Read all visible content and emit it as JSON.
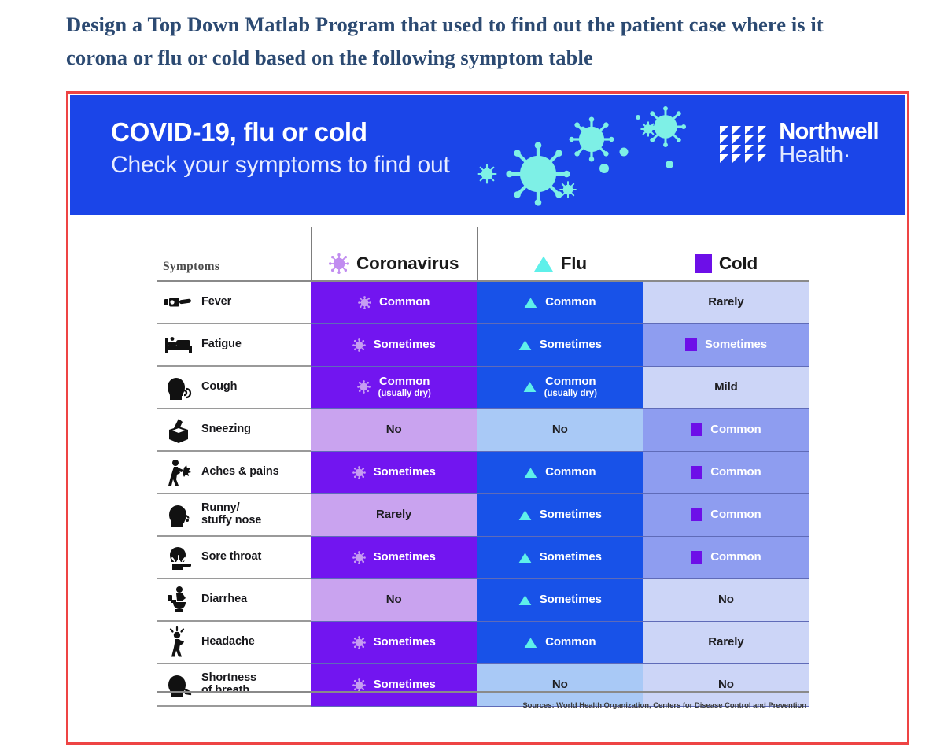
{
  "heading": "Design a Top Down Matlab Program that used to find out the patient case where is it corona or flu or cold based on the following symptom table",
  "banner": {
    "title": "COVID-19, flu or cold",
    "subtitle": "Check your symptoms to find out",
    "background_color": "#1b45e8",
    "virus_art_color": "#7ef0e6",
    "logo": {
      "word_1": "Northwell",
      "word_2": "Health·",
      "mark_icon": "northwell-triangle-grid-icon"
    }
  },
  "table": {
    "symptoms_header": "Symptoms",
    "columns": [
      {
        "label": "Coronavirus",
        "icon": "coronavirus-icon",
        "accent": "#c18cf0"
      },
      {
        "label": "Flu",
        "icon": "triangle-icon",
        "accent": "#5ef0ea"
      },
      {
        "label": "Cold",
        "icon": "square-icon",
        "accent": "#6d0fe8"
      }
    ],
    "rows": [
      {
        "symptom": "Fever",
        "icon": "thermometer-icon",
        "cells": [
          {
            "text": "Common",
            "sub": "",
            "icon": "coronavirus-icon",
            "tone": "cv-strong",
            "text_color": "t-white"
          },
          {
            "text": "Common",
            "sub": "",
            "icon": "triangle-icon",
            "tone": "fl-strong",
            "text_color": "t-white"
          },
          {
            "text": "Rarely",
            "sub": "",
            "icon": "",
            "tone": "cd-light",
            "text_color": "t-dark"
          }
        ]
      },
      {
        "symptom": "Fatigue",
        "icon": "bed-icon",
        "cells": [
          {
            "text": "Sometimes",
            "sub": "",
            "icon": "coronavirus-icon",
            "tone": "cv-strong",
            "text_color": "t-white"
          },
          {
            "text": "Sometimes",
            "sub": "",
            "icon": "triangle-icon",
            "tone": "fl-strong",
            "text_color": "t-white"
          },
          {
            "text": "Sometimes",
            "sub": "",
            "icon": "square-icon",
            "tone": "cd-strong",
            "text_color": "t-white"
          }
        ]
      },
      {
        "symptom": "Cough",
        "icon": "coughing-head-icon",
        "cells": [
          {
            "text": "Common",
            "sub": "(usually dry)",
            "icon": "coronavirus-icon",
            "tone": "cv-strong",
            "text_color": "t-white"
          },
          {
            "text": "Common",
            "sub": "(usually dry)",
            "icon": "triangle-icon",
            "tone": "fl-strong",
            "text_color": "t-white"
          },
          {
            "text": "Mild",
            "sub": "",
            "icon": "",
            "tone": "cd-light",
            "text_color": "t-dark"
          }
        ]
      },
      {
        "symptom": "Sneezing",
        "icon": "tissue-box-icon",
        "cells": [
          {
            "text": "No",
            "sub": "",
            "icon": "",
            "tone": "cv-light",
            "text_color": "t-dark"
          },
          {
            "text": "No",
            "sub": "",
            "icon": "",
            "tone": "fl-light",
            "text_color": "t-dark"
          },
          {
            "text": "Common",
            "sub": "",
            "icon": "square-icon",
            "tone": "cd-strong",
            "text_color": "t-white"
          }
        ]
      },
      {
        "symptom": "Aches & pains",
        "icon": "body-ache-icon",
        "cells": [
          {
            "text": "Sometimes",
            "sub": "",
            "icon": "coronavirus-icon",
            "tone": "cv-strong",
            "text_color": "t-white"
          },
          {
            "text": "Common",
            "sub": "",
            "icon": "triangle-icon",
            "tone": "fl-strong",
            "text_color": "t-white"
          },
          {
            "text": "Common",
            "sub": "",
            "icon": "square-icon",
            "tone": "cd-strong",
            "text_color": "t-white"
          }
        ]
      },
      {
        "symptom": "Runny/\nstuffy nose",
        "icon": "runny-nose-icon",
        "cells": [
          {
            "text": "Rarely",
            "sub": "",
            "icon": "",
            "tone": "cv-light",
            "text_color": "t-dark"
          },
          {
            "text": "Sometimes",
            "sub": "",
            "icon": "triangle-icon",
            "tone": "fl-strong",
            "text_color": "t-white"
          },
          {
            "text": "Common",
            "sub": "",
            "icon": "square-icon",
            "tone": "cd-strong",
            "text_color": "t-white"
          }
        ]
      },
      {
        "symptom": "Sore throat",
        "icon": "sore-throat-icon",
        "cells": [
          {
            "text": "Sometimes",
            "sub": "",
            "icon": "coronavirus-icon",
            "tone": "cv-strong",
            "text_color": "t-white"
          },
          {
            "text": "Sometimes",
            "sub": "",
            "icon": "triangle-icon",
            "tone": "fl-strong",
            "text_color": "t-white"
          },
          {
            "text": "Common",
            "sub": "",
            "icon": "square-icon",
            "tone": "cd-strong",
            "text_color": "t-white"
          }
        ]
      },
      {
        "symptom": "Diarrhea",
        "icon": "toilet-icon",
        "cells": [
          {
            "text": "No",
            "sub": "",
            "icon": "",
            "tone": "cv-light",
            "text_color": "t-dark"
          },
          {
            "text": "Sometimes",
            "sub": "",
            "icon": "triangle-icon",
            "tone": "fl-strong",
            "text_color": "t-white"
          },
          {
            "text": "No",
            "sub": "",
            "icon": "",
            "tone": "cd-light",
            "text_color": "t-dark"
          }
        ]
      },
      {
        "symptom": "Headache",
        "icon": "headache-icon",
        "cells": [
          {
            "text": "Sometimes",
            "sub": "",
            "icon": "coronavirus-icon",
            "tone": "cv-strong",
            "text_color": "t-white"
          },
          {
            "text": "Common",
            "sub": "",
            "icon": "triangle-icon",
            "tone": "fl-strong",
            "text_color": "t-white"
          },
          {
            "text": "Rarely",
            "sub": "",
            "icon": "",
            "tone": "cd-light",
            "text_color": "t-dark"
          }
        ]
      },
      {
        "symptom": "Shortness\nof breath",
        "icon": "shortness-of-breath-icon",
        "cells": [
          {
            "text": "Sometimes",
            "sub": "",
            "icon": "coronavirus-icon",
            "tone": "cv-strong",
            "text_color": "t-white"
          },
          {
            "text": "No",
            "sub": "",
            "icon": "",
            "tone": "fl-light",
            "text_color": "t-dark"
          },
          {
            "text": "No",
            "sub": "",
            "icon": "",
            "tone": "cd-light",
            "text_color": "t-dark"
          }
        ]
      }
    ]
  },
  "source_note": "Sources: World Health Organization, Centers for Disease Control and Prevention"
}
